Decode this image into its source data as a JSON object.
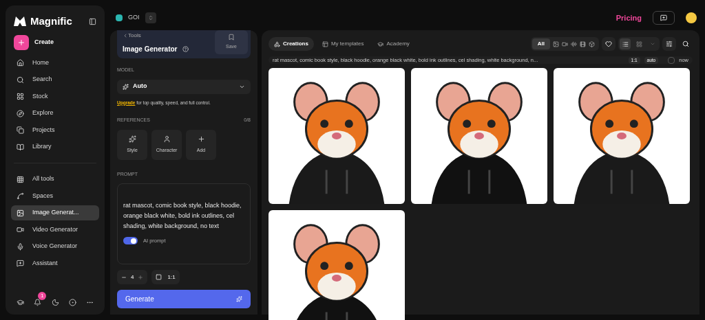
{
  "brand": "Magnific",
  "create": "Create",
  "nav": [
    {
      "label": "Home",
      "selected": false
    },
    {
      "label": "Search",
      "selected": false
    },
    {
      "label": "Stock",
      "selected": false
    },
    {
      "label": "Explore",
      "selected": false
    },
    {
      "label": "Projects",
      "selected": false
    },
    {
      "label": "Library",
      "selected": false
    }
  ],
  "tools": [
    {
      "label": "All tools",
      "selected": false
    },
    {
      "label": "Spaces",
      "selected": false
    },
    {
      "label": "Image Generat...",
      "selected": true
    },
    {
      "label": "Video Generator",
      "selected": false
    },
    {
      "label": "Voice Generator",
      "selected": false
    },
    {
      "label": "Assistant",
      "selected": false
    }
  ],
  "notifications": "1",
  "workspace": "GOI",
  "pricing": "Pricing",
  "tool": {
    "back": "Tools",
    "title": "Image Generator",
    "save": "Save"
  },
  "model": {
    "label": "MODEL",
    "value": "Auto",
    "upgrade_link": "Upgrade",
    "upgrade_text": " for top quality, speed, and full control."
  },
  "references": {
    "label": "REFERENCES",
    "count": "0/8",
    "items": [
      "Style",
      "Character",
      "Add"
    ]
  },
  "prompt": {
    "label": "PROMPT",
    "value": "rat mascot, comic book style, black hoodie, orange black white, bold ink outlines, cel shading, white background, no text",
    "ai_prompt_label": "AI prompt",
    "ai_prompt_on": true
  },
  "count": "4",
  "ratio": "1:1",
  "generate": "Generate",
  "tabs": [
    {
      "label": "Creations",
      "selected": true
    },
    {
      "label": "My templates",
      "selected": false
    },
    {
      "label": "Academy",
      "selected": false
    }
  ],
  "filter_all": {
    "label": "All",
    "selected": true
  },
  "views": [
    {
      "kind": "list",
      "selected": true
    },
    {
      "kind": "grid",
      "selected": false
    }
  ],
  "result": {
    "prompt": "rat mascot, comic book style, black hoodie, orange black white, bold ink outlines, cel shading, white background, n...",
    "ratio": "1:1",
    "mode": "auto",
    "checked": false,
    "time": "now"
  }
}
